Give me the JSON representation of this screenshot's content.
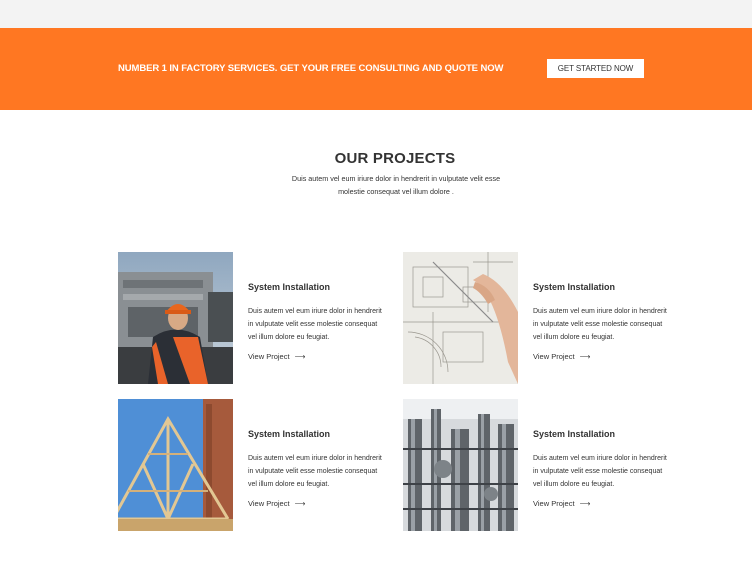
{
  "banner": {
    "text": "NUMBER 1 IN FACTORY SERVICES. GET YOUR FREE CONSULTING AND QUOTE NOW",
    "button_label": "GET STARTED NOW",
    "color": "#ff7722"
  },
  "projects": {
    "title": "OUR PROJECTS",
    "subtitle": "Duis autem vel eum iriure dolor in hendrerit in vulputate velit esse molestie consequat vel illum dolore .",
    "items": [
      {
        "title": "System Installation",
        "description": "Duis autem vel eum iriure dolor in hendrerit in vulputate velit esse molestie consequat vel illum dolore eu feugiat.",
        "link": "View Project",
        "arrow": "⟶"
      },
      {
        "title": "System Installation",
        "description": "Duis autem vel eum iriure dolor in hendrerit in vulputate velit esse molestie consequat vel illum dolore eu feugiat.",
        "link": "View Project",
        "arrow": "⟶"
      },
      {
        "title": "System Installation",
        "description": "Duis autem vel eum iriure dolor in hendrerit in vulputate velit esse molestie consequat vel illum dolore eu feugiat.",
        "link": "View Project",
        "arrow": "⟶"
      },
      {
        "title": "System Installation",
        "description": "Duis autem vel eum iriure dolor in hendrerit in vulputate velit esse molestie consequat vel illum dolore eu feugiat.",
        "link": "View Project",
        "arrow": "⟶"
      }
    ]
  }
}
